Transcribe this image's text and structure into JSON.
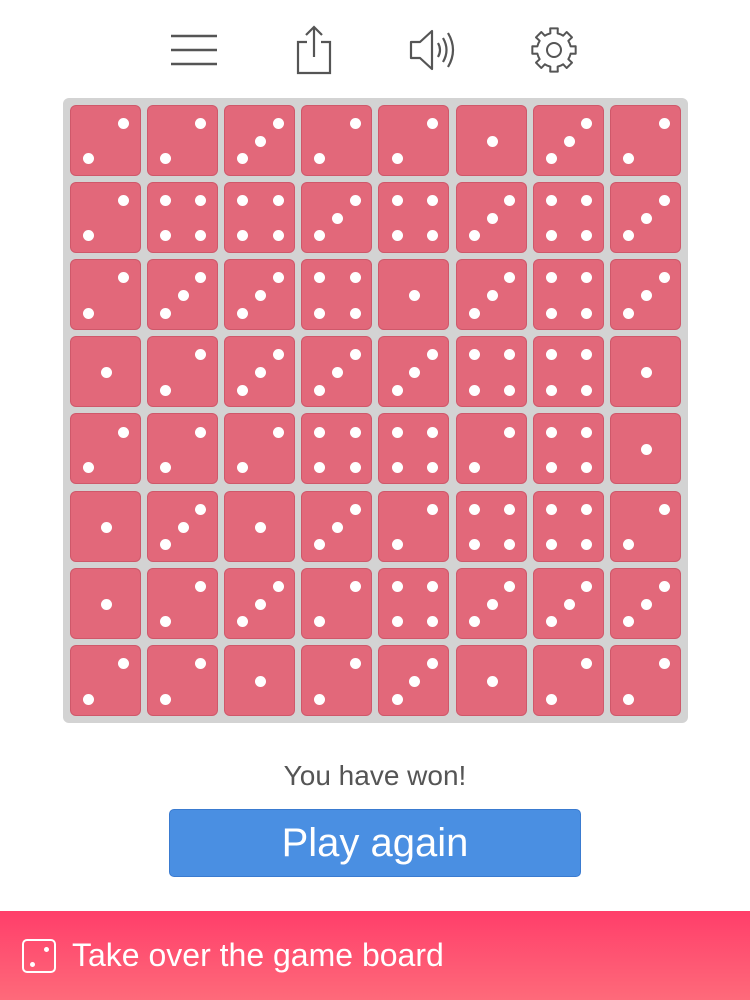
{
  "colors": {
    "die_face": "#e2687a",
    "pip": "#ffffff",
    "board_bg": "#d3d3d3",
    "button_bg": "#4a8fe2",
    "banner_gradient_top": "#ff3e6a",
    "banner_gradient_bottom": "#fe6a7a",
    "icon_stroke": "#555555"
  },
  "toolbar": {
    "icons": [
      "menu-icon",
      "share-icon",
      "sound-icon",
      "settings-icon"
    ]
  },
  "board": {
    "rows": 8,
    "cols": 8,
    "dice": [
      [
        2,
        2,
        3,
        2,
        2,
        1,
        3,
        2
      ],
      [
        2,
        4,
        4,
        3,
        4,
        3,
        4,
        3
      ],
      [
        2,
        3,
        3,
        4,
        1,
        3,
        4,
        3
      ],
      [
        1,
        2,
        3,
        3,
        3,
        4,
        4,
        1
      ],
      [
        2,
        2,
        2,
        4,
        4,
        2,
        4,
        1
      ],
      [
        1,
        3,
        1,
        3,
        2,
        4,
        4,
        2
      ],
      [
        1,
        2,
        3,
        2,
        4,
        3,
        3,
        3
      ],
      [
        2,
        2,
        1,
        2,
        3,
        1,
        2,
        2
      ]
    ]
  },
  "status": {
    "message": "You have won!"
  },
  "play_again": {
    "label": "Play again"
  },
  "banner": {
    "icon": "die-icon",
    "text": "Take over the game board"
  }
}
